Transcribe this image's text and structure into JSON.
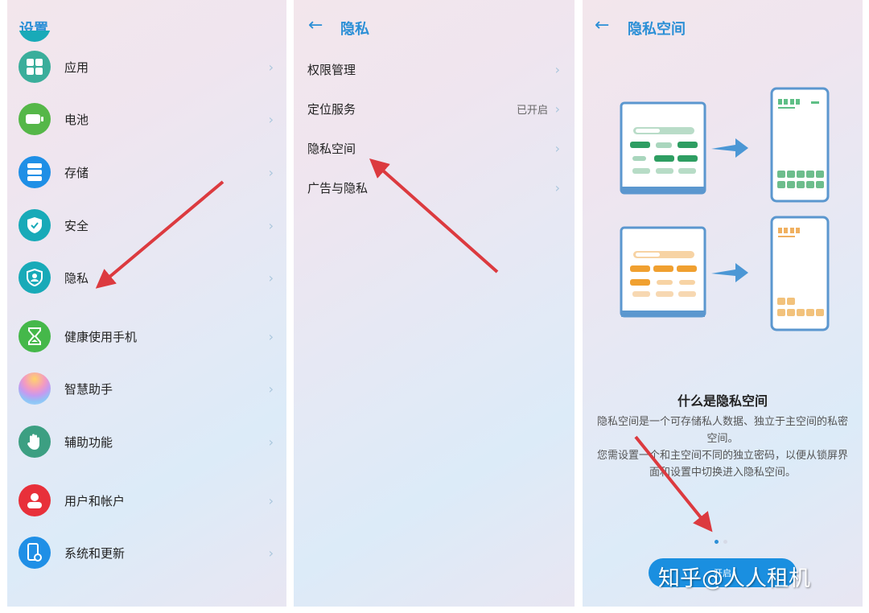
{
  "panels": {
    "settings": {
      "title": "设置",
      "items": [
        {
          "label": "应用",
          "icon": "apps-grid-icon",
          "color": "#3aae9b"
        },
        {
          "label": "电池",
          "icon": "battery-icon",
          "color": "#55b748"
        },
        {
          "label": "存储",
          "icon": "storage-icon",
          "color": "#1f8fe6"
        },
        {
          "label": "安全",
          "icon": "shield-check-icon",
          "color": "#18aab8"
        },
        {
          "label": "隐私",
          "icon": "privacy-shield-icon",
          "color": "#18aab8"
        },
        {
          "label": "健康使用手机",
          "icon": "hourglass-icon",
          "color": "#45b84a"
        },
        {
          "label": "智慧助手",
          "icon": "assistant-orb-icon",
          "color": "#e6a0c8"
        },
        {
          "label": "辅助功能",
          "icon": "hand-icon",
          "color": "#3c9f82"
        },
        {
          "label": "用户和帐户",
          "icon": "user-icon",
          "color": "#e8303a"
        },
        {
          "label": "系统和更新",
          "icon": "phone-gear-icon",
          "color": "#1f8fe6"
        }
      ],
      "chevron": "›"
    },
    "privacy": {
      "back": "←",
      "title": "隐私",
      "items": [
        {
          "label": "权限管理",
          "value": ""
        },
        {
          "label": "定位服务",
          "value": "已开启"
        },
        {
          "label": "隐私空间",
          "value": ""
        },
        {
          "label": "广告与隐私",
          "value": ""
        }
      ],
      "chevron": "›"
    },
    "private_space": {
      "back": "←",
      "title": "隐私空间",
      "info_title": "什么是隐私空间",
      "info_line1": "隐私空间是一个可存储私人数据、独立于主空间的私密空间。",
      "info_line2": "您需设置一个和主空间不同的独立密码，以便从锁屏界面和设置中切换进入隐私空间。",
      "page_indicator": {
        "current": 1,
        "total": 2
      },
      "start_button": "开启",
      "colors": {
        "accent": "#2b8fd6",
        "green": "#2e9e62",
        "orange": "#f0a030"
      }
    }
  },
  "watermark": "知乎@人人租机"
}
